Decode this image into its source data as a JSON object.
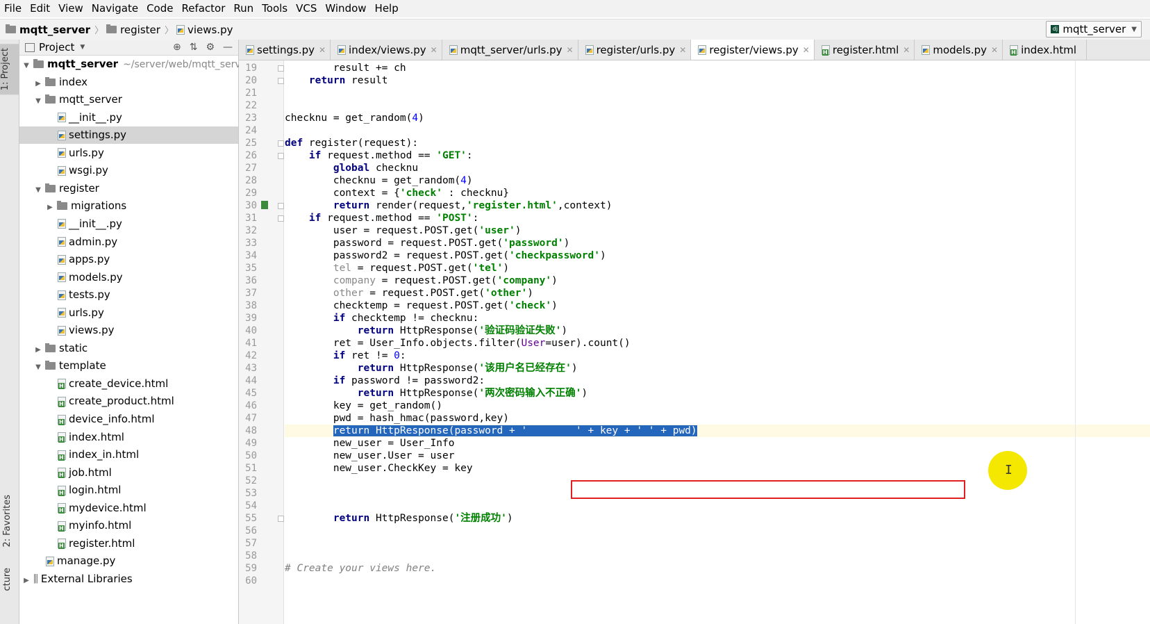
{
  "menu": [
    "File",
    "Edit",
    "View",
    "Navigate",
    "Code",
    "Refactor",
    "Run",
    "Tools",
    "VCS",
    "Window",
    "Help"
  ],
  "breadcrumb": {
    "project": "mqtt_server",
    "folder": "register",
    "file": "views.py"
  },
  "run_config": "mqtt_server",
  "left_tabs": {
    "project": "1: Project",
    "favorites": "2: Favorites",
    "structure": "cture"
  },
  "project_panel": {
    "title": "Project"
  },
  "tree": [
    {
      "label": "mqtt_server",
      "extra": "~/server/web/mqtt_server",
      "depth": 0,
      "type": "root",
      "arrow": "▼"
    },
    {
      "label": "index",
      "depth": 1,
      "type": "folder",
      "arrow": "▶"
    },
    {
      "label": "mqtt_server",
      "depth": 1,
      "type": "folder",
      "arrow": "▼"
    },
    {
      "label": "__init__.py",
      "depth": 2,
      "type": "py"
    },
    {
      "label": "settings.py",
      "depth": 2,
      "type": "py",
      "selected": true
    },
    {
      "label": "urls.py",
      "depth": 2,
      "type": "py"
    },
    {
      "label": "wsgi.py",
      "depth": 2,
      "type": "py"
    },
    {
      "label": "register",
      "depth": 1,
      "type": "folder",
      "arrow": "▼"
    },
    {
      "label": "migrations",
      "depth": 2,
      "type": "folder",
      "arrow": "▶"
    },
    {
      "label": "__init__.py",
      "depth": 2,
      "type": "py"
    },
    {
      "label": "admin.py",
      "depth": 2,
      "type": "py"
    },
    {
      "label": "apps.py",
      "depth": 2,
      "type": "py"
    },
    {
      "label": "models.py",
      "depth": 2,
      "type": "py"
    },
    {
      "label": "tests.py",
      "depth": 2,
      "type": "py"
    },
    {
      "label": "urls.py",
      "depth": 2,
      "type": "py"
    },
    {
      "label": "views.py",
      "depth": 2,
      "type": "py"
    },
    {
      "label": "static",
      "depth": 1,
      "type": "folder",
      "arrow": "▶"
    },
    {
      "label": "template",
      "depth": 1,
      "type": "folder",
      "arrow": "▼"
    },
    {
      "label": "create_device.html",
      "depth": 2,
      "type": "html"
    },
    {
      "label": "create_product.html",
      "depth": 2,
      "type": "html"
    },
    {
      "label": "device_info.html",
      "depth": 2,
      "type": "html"
    },
    {
      "label": "index.html",
      "depth": 2,
      "type": "html"
    },
    {
      "label": "index_in.html",
      "depth": 2,
      "type": "html"
    },
    {
      "label": "job.html",
      "depth": 2,
      "type": "html"
    },
    {
      "label": "login.html",
      "depth": 2,
      "type": "html"
    },
    {
      "label": "mydevice.html",
      "depth": 2,
      "type": "html"
    },
    {
      "label": "myinfo.html",
      "depth": 2,
      "type": "html"
    },
    {
      "label": "register.html",
      "depth": 2,
      "type": "html"
    },
    {
      "label": "manage.py",
      "depth": 1,
      "type": "py"
    },
    {
      "label": "External Libraries",
      "depth": 0,
      "type": "lib",
      "arrow": "▶"
    }
  ],
  "tabs": [
    {
      "label": "settings.py",
      "type": "py"
    },
    {
      "label": "index/views.py",
      "type": "py"
    },
    {
      "label": "mqtt_server/urls.py",
      "type": "py"
    },
    {
      "label": "register/urls.py",
      "type": "py"
    },
    {
      "label": "register/views.py",
      "type": "py",
      "active": true
    },
    {
      "label": "register.html",
      "type": "html"
    },
    {
      "label": "models.py",
      "type": "py"
    },
    {
      "label": "index.html",
      "type": "html",
      "noclose": true
    }
  ],
  "code": {
    "first_line": 19,
    "current_line": 48,
    "lines": [
      [
        [
          "",
          "        result += ch"
        ]
      ],
      [
        [
          "",
          "    "
        ],
        [
          "kw",
          "return"
        ],
        [
          "",
          " result"
        ]
      ],
      [],
      [],
      [
        [
          "",
          "checknu = get_random("
        ],
        [
          "num",
          "4"
        ],
        [
          "",
          ")"
        ]
      ],
      [],
      [
        [
          "kw",
          "def"
        ],
        [
          "",
          " register(request):"
        ]
      ],
      [
        [
          "",
          "    "
        ],
        [
          "kw",
          "if"
        ],
        [
          "",
          " request.method == "
        ],
        [
          "str",
          "'GET'"
        ],
        [
          "",
          ":"
        ]
      ],
      [
        [
          "",
          "        "
        ],
        [
          "kw",
          "global"
        ],
        [
          "",
          " checknu"
        ]
      ],
      [
        [
          "",
          "        checknu = get_random("
        ],
        [
          "num",
          "4"
        ],
        [
          "",
          ")"
        ]
      ],
      [
        [
          "",
          "        context = {"
        ],
        [
          "str",
          "'check'"
        ],
        [
          "",
          " : checknu}"
        ]
      ],
      [
        [
          "",
          "        "
        ],
        [
          "kw",
          "return"
        ],
        [
          "",
          " render(request,"
        ],
        [
          "str",
          "'register.html'"
        ],
        [
          "",
          ",context)"
        ]
      ],
      [
        [
          "",
          "    "
        ],
        [
          "kw",
          "if"
        ],
        [
          "",
          " request.method == "
        ],
        [
          "str",
          "'POST'"
        ],
        [
          "",
          ":"
        ]
      ],
      [
        [
          "",
          "        user = request.POST.get("
        ],
        [
          "str",
          "'user'"
        ],
        [
          "",
          ")"
        ]
      ],
      [
        [
          "",
          "        password = request.POST.get("
        ],
        [
          "str",
          "'password'"
        ],
        [
          "",
          ")"
        ]
      ],
      [
        [
          "",
          "        password2 = request.POST.get("
        ],
        [
          "str",
          "'checkpassword'"
        ],
        [
          "",
          ")"
        ]
      ],
      [
        [
          "",
          "        "
        ],
        [
          "grey",
          "tel"
        ],
        [
          "",
          " = request.POST.get("
        ],
        [
          "str",
          "'tel'"
        ],
        [
          "",
          ")"
        ]
      ],
      [
        [
          "",
          "        "
        ],
        [
          "grey",
          "company"
        ],
        [
          "",
          " = request.POST.get("
        ],
        [
          "str",
          "'company'"
        ],
        [
          "",
          ")"
        ]
      ],
      [
        [
          "",
          "        "
        ],
        [
          "grey",
          "other"
        ],
        [
          "",
          " = request.POST.get("
        ],
        [
          "str",
          "'other'"
        ],
        [
          "",
          ")"
        ]
      ],
      [
        [
          "",
          "        checktemp = request.POST.get("
        ],
        [
          "str",
          "'check'"
        ],
        [
          "",
          ")"
        ]
      ],
      [
        [
          "",
          "        "
        ],
        [
          "kw",
          "if"
        ],
        [
          "",
          " checktemp != checknu:"
        ]
      ],
      [
        [
          "",
          "            "
        ],
        [
          "kw",
          "return"
        ],
        [
          "",
          " HttpResponse("
        ],
        [
          "str",
          "'验证码验证失败'"
        ],
        [
          "",
          ")"
        ]
      ],
      [
        [
          "",
          "        ret = User_Info.objects.filter("
        ],
        [
          "param",
          "User"
        ],
        [
          "",
          "=user).count()"
        ]
      ],
      [
        [
          "",
          "        "
        ],
        [
          "kw",
          "if"
        ],
        [
          "",
          " ret != "
        ],
        [
          "num",
          "0"
        ],
        [
          "",
          ":"
        ]
      ],
      [
        [
          "",
          "            "
        ],
        [
          "kw",
          "return"
        ],
        [
          "",
          " HttpResponse("
        ],
        [
          "str",
          "'该用户名已经存在'"
        ],
        [
          "",
          ")"
        ]
      ],
      [
        [
          "",
          "        "
        ],
        [
          "kw",
          "if"
        ],
        [
          "",
          " password != password2:"
        ]
      ],
      [
        [
          "",
          "            "
        ],
        [
          "kw",
          "return"
        ],
        [
          "",
          " HttpResponse("
        ],
        [
          "str",
          "'两次密码输入不正确'"
        ],
        [
          "",
          ")"
        ]
      ],
      [
        [
          "",
          "        key = get_random()"
        ]
      ],
      [
        [
          "",
          "        pwd = hash_hmac(password,key)"
        ]
      ],
      [
        [
          "",
          "        "
        ],
        [
          "sel",
          "return HttpResponse(password + '        ' + key + ' ' + pwd)"
        ]
      ],
      [
        [
          "",
          "        new_user = User_Info"
        ]
      ],
      [
        [
          "",
          "        new_user.User = user"
        ]
      ],
      [
        [
          "",
          "        new_user.CheckKey = key"
        ]
      ],
      [],
      [],
      [],
      [
        [
          "",
          "        "
        ],
        [
          "kw",
          "return"
        ],
        [
          "",
          " HttpResponse("
        ],
        [
          "str",
          "'注册成功'"
        ],
        [
          "",
          ")"
        ]
      ],
      [],
      [],
      [],
      [
        [
          "cmt",
          "# Create your views here."
        ]
      ],
      []
    ]
  }
}
